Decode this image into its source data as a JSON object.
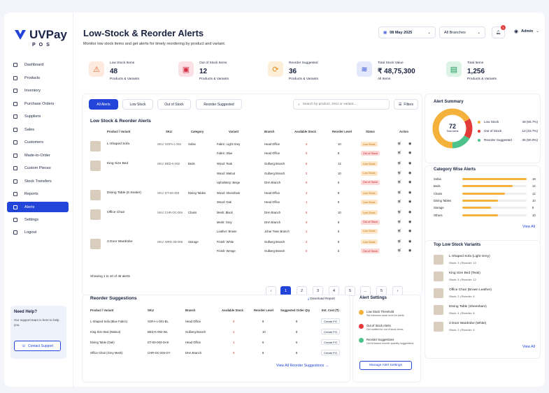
{
  "app": {
    "name": "UVPay",
    "sub": "POS"
  },
  "nav": [
    {
      "label": "Dashboard",
      "icon": "home-icon"
    },
    {
      "label": "Products",
      "icon": "grid-icon"
    },
    {
      "label": "Inventory",
      "icon": "inventory-icon"
    },
    {
      "label": "Purchase Orders",
      "icon": "purchase-icon"
    },
    {
      "label": "Suppliers",
      "icon": "suppliers-icon"
    },
    {
      "label": "Sales",
      "icon": "sales-icon"
    },
    {
      "label": "Customers",
      "icon": "customers-icon"
    },
    {
      "label": "Made-to-Order",
      "icon": "order-icon"
    },
    {
      "label": "Custom Pieces",
      "icon": "custom-icon"
    },
    {
      "label": "Stock Transfers",
      "icon": "transfer-icon"
    },
    {
      "label": "Reports",
      "icon": "reports-icon"
    },
    {
      "label": "Alerts",
      "icon": "bell-icon"
    },
    {
      "label": "Settings",
      "icon": "gear-icon"
    },
    {
      "label": "Logout",
      "icon": "logout-icon"
    }
  ],
  "help": {
    "title": "Need Help?",
    "text": "Our support team is here to help you.",
    "button": "Contact Support"
  },
  "header": {
    "title": "Low-Stock & Reorder Alerts",
    "subtitle": "Monitor low stock items and get alerts for timely reordering by product and variant.",
    "date": "08 May 2025",
    "branch": "All Branches",
    "notif_count": "3",
    "user": "Admin"
  },
  "kpis": [
    {
      "label": "Low Stock Items",
      "value": "48",
      "sub": "Products & Variants",
      "color": "#e96a2c",
      "bg": "#fde9dd",
      "icon": "warning-icon",
      "glyph": "⚠"
    },
    {
      "label": "Out of Stock Items",
      "value": "12",
      "sub": "Products & Variants",
      "color": "#d72f4a",
      "bg": "#fbe1e5",
      "icon": "box-icon",
      "glyph": "▣"
    },
    {
      "label": "Reorder Suggested",
      "value": "36",
      "sub": "Products & Variants",
      "color": "#e58a1f",
      "bg": "#fdeed7",
      "icon": "refresh-icon",
      "glyph": "⟳"
    },
    {
      "label": "Total Stock Value",
      "value": "₹ 48,75,300",
      "sub": "All Items",
      "color": "#2344d8",
      "bg": "#e3e8fb",
      "icon": "layers-icon",
      "glyph": "≋"
    },
    {
      "label": "Total Items",
      "value": "1,256",
      "sub": "Products & Variants",
      "color": "#1e9b5a",
      "bg": "#dcf3e6",
      "icon": "cube-icon",
      "glyph": "▤"
    }
  ],
  "tabs": [
    "All Alerts",
    "Low Stock",
    "Out of Stock",
    "Reorder Suggested"
  ],
  "search_placeholder": "Search by product, SKU or variant...",
  "filters_label": "Filters",
  "table": {
    "title": "Low Stock & Reorder Alerts",
    "headers": [
      "Product / Variant",
      "SKU",
      "Category",
      "Variant",
      "Branch",
      "Available Stock",
      "Reorder Level",
      "Status",
      "Action"
    ],
    "products": [
      {
        "name": "L-Shaped Sofa",
        "sku": "SKU: SOFA-L-001",
        "category": "Sofas",
        "rows": [
          {
            "variant": "Fabric: Light Grey",
            "branch": "Head Office",
            "stock": "3",
            "level": "10",
            "status": "Low Stock"
          },
          {
            "variant": "Fabric: Blue",
            "branch": "Head Office",
            "stock": "0",
            "level": "8",
            "status": "Out of Stock"
          }
        ]
      },
      {
        "name": "King Size Bed",
        "sku": "SKU: BED-K-002",
        "category": "Beds",
        "rows": [
          {
            "variant": "Wood: Teak",
            "branch": "Gulberg Branch",
            "stock": "5",
            "level": "12",
            "status": "Low Stock"
          },
          {
            "variant": "Wood: Walnut",
            "branch": "Gulberg Branch",
            "stock": "2",
            "level": "10",
            "status": "Low Stock"
          },
          {
            "variant": "Upholstery: Beige",
            "branch": "DHA Branch",
            "stock": "0",
            "level": "6",
            "status": "Out of Stock"
          }
        ]
      },
      {
        "name": "Dining Table (6 Seater)",
        "sku": "SKU: DT-6S-003",
        "category": "Dining Tables",
        "rows": [
          {
            "variant": "Wood: Sheesham",
            "branch": "Head Office",
            "stock": "4",
            "level": "8",
            "status": "Low Stock"
          },
          {
            "variant": "Wood: Oak",
            "branch": "Head Office",
            "stock": "1",
            "level": "6",
            "status": "Low Stock"
          }
        ]
      },
      {
        "name": "Office Chair",
        "sku": "SKU: CHR-OC-004",
        "category": "Chairs",
        "rows": [
          {
            "variant": "Mesh: Black",
            "branch": "DHA Branch",
            "stock": "6",
            "level": "10",
            "status": "Low Stock"
          },
          {
            "variant": "Mesh: Grey",
            "branch": "DHA Branch",
            "stock": "0",
            "level": "8",
            "status": "Out of Stock"
          },
          {
            "variant": "Leather: Brown",
            "branch": "Johar Town Branch",
            "stock": "2",
            "level": "6",
            "status": "Low Stock"
          }
        ]
      },
      {
        "name": "3 Door Wardrobe",
        "sku": "SKU: WRD-3D-005",
        "category": "Storage",
        "rows": [
          {
            "variant": "Finish: White",
            "branch": "Gulberg Branch",
            "stock": "2",
            "level": "6",
            "status": "Low Stock"
          },
          {
            "variant": "Finish: Wenge",
            "branch": "Gulberg Branch",
            "stock": "0",
            "level": "5",
            "status": "Out of Stock"
          }
        ]
      }
    ],
    "showing": "Showing 1 to 10 of 48 alerts",
    "pages": [
      "‹",
      "1",
      "2",
      "3",
      "4",
      "5",
      "...",
      "5",
      "›"
    ]
  },
  "summary": {
    "title": "Alert Summary",
    "total": "72",
    "total_label": "Total Alerts",
    "items": [
      {
        "label": "Low Stock",
        "value": "48 (66.7%)",
        "pct": 66.7,
        "color": "#f4b23c"
      },
      {
        "label": "Out of Stock",
        "value": "12 (16.7%)",
        "pct": 16.7,
        "color": "#e33a3a"
      },
      {
        "label": "Reorder Suggested",
        "value": "36 (50.0%)",
        "pct": 16.6,
        "color": "#4cc38a"
      }
    ]
  },
  "category": {
    "title": "Category Wise Alerts",
    "items": [
      {
        "label": "Sofas",
        "value": "18"
      },
      {
        "label": "Beds",
        "value": "14"
      },
      {
        "label": "Chairs",
        "value": "12"
      },
      {
        "label": "Dining Tables",
        "value": "10"
      },
      {
        "label": "Storage",
        "value": "8"
      },
      {
        "label": "Others",
        "value": "10"
      }
    ],
    "max": 18,
    "view_all": "View All"
  },
  "top_variants": {
    "title": "Top Low Stock Variants",
    "items": [
      {
        "name": "L-Shaped Sofa (Light Grey)",
        "meta": "Stock: 3   |   Reorder: 10"
      },
      {
        "name": "King Size Bed (Teak)",
        "meta": "Stock: 5   |   Reorder: 12"
      },
      {
        "name": "Office Chair (Brown Leather)",
        "meta": "Stock: 2   |   Reorder: 6"
      },
      {
        "name": "Dining Table (Sheesham)",
        "meta": "Stock: 4   |   Reorder: 8"
      },
      {
        "name": "3 Door Wardrobe (White)",
        "meta": "Stock: 2   |   Reorder: 6"
      }
    ],
    "view_all": "View All"
  },
  "reorder": {
    "title": "Reorder Suggestions",
    "download": "Download Report",
    "headers": [
      "Product / Variant",
      "SKU",
      "Branch",
      "Available Stock",
      "Reorder Level",
      "Suggested Order Qty",
      "Est. Cost (₹)"
    ],
    "rows": [
      {
        "product": "L-Shaped Sofa (Blue Fabric)",
        "sku": "SOFA-L-001-BL",
        "branch": "Head Office",
        "stock": "0",
        "level": "8",
        "qty": "8",
        "action": "Create PO"
      },
      {
        "product": "King Size Bed (Walnut)",
        "sku": "BED-K-002-WL",
        "branch": "Gulberg Branch",
        "stock": "2",
        "level": "10",
        "qty": "8",
        "action": "Create PO"
      },
      {
        "product": "Dining Table (Oak)",
        "sku": "DT-6S-003-OAK",
        "branch": "Head Office",
        "stock": "1",
        "level": "6",
        "qty": "5",
        "action": "Create PO"
      },
      {
        "product": "Office Chair (Grey Mesh)",
        "sku": "CHR-OC-004-GY",
        "branch": "DHA Branch",
        "stock": "0",
        "level": "8",
        "qty": "8",
        "action": "Create PO"
      }
    ],
    "view_all": "View All Reorder Suggestions →"
  },
  "settings": {
    "title": "Alert Settings",
    "items": [
      {
        "title": "Low Stock Threshold",
        "desc": "Set minimum stock level for alerts",
        "color": "#f4b23c"
      },
      {
        "title": "Out of Stock Alerts",
        "desc": "Get notified for out of stock items",
        "color": "#e33a3a"
      },
      {
        "title": "Reorder Suggestions",
        "desc": "Get AI-based reorder quantity suggestions",
        "color": "#4cc38a"
      }
    ],
    "button": "Manage Alert Settings"
  }
}
